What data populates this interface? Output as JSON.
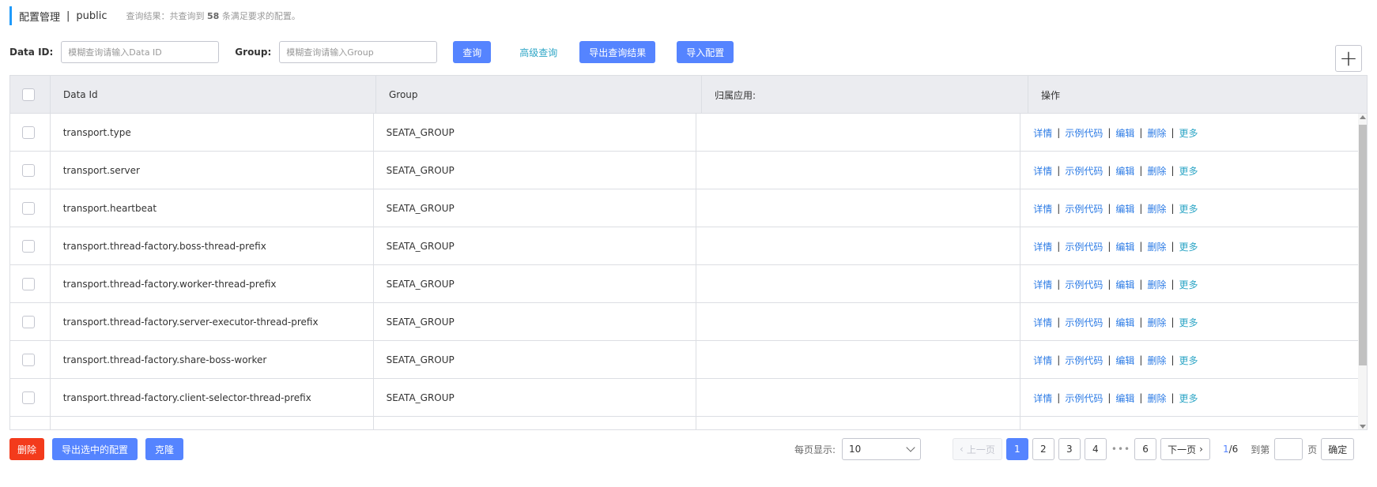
{
  "header": {
    "title": "配置管理",
    "separator": "|",
    "namespace": "public",
    "result_prefix": "查询结果：共查询到",
    "result_count": "58",
    "result_suffix": "条满足要求的配置。"
  },
  "search": {
    "data_id_label": "Data ID:",
    "data_id_placeholder": "模糊查询请输入Data ID",
    "group_label": "Group:",
    "group_placeholder": "模糊查询请输入Group",
    "query_button": "查询",
    "advanced_query": "高级查询",
    "export_results": "导出查询结果",
    "import_config": "导入配置",
    "add_icon": "plus-icon"
  },
  "table": {
    "columns": [
      "Data Id",
      "Group",
      "归属应用:",
      "操作"
    ],
    "rows": [
      {
        "data_id": "transport.type",
        "group": "SEATA_GROUP",
        "app": ""
      },
      {
        "data_id": "transport.server",
        "group": "SEATA_GROUP",
        "app": ""
      },
      {
        "data_id": "transport.heartbeat",
        "group": "SEATA_GROUP",
        "app": ""
      },
      {
        "data_id": "transport.thread-factory.boss-thread-prefix",
        "group": "SEATA_GROUP",
        "app": ""
      },
      {
        "data_id": "transport.thread-factory.worker-thread-prefix",
        "group": "SEATA_GROUP",
        "app": ""
      },
      {
        "data_id": "transport.thread-factory.server-executor-thread-prefix",
        "group": "SEATA_GROUP",
        "app": ""
      },
      {
        "data_id": "transport.thread-factory.share-boss-worker",
        "group": "SEATA_GROUP",
        "app": ""
      },
      {
        "data_id": "transport.thread-factory.client-selector-thread-prefix",
        "group": "SEATA_GROUP",
        "app": ""
      }
    ],
    "ops": {
      "detail": "详情",
      "sample_code": "示例代码",
      "edit": "编辑",
      "delete": "删除",
      "more": "更多",
      "sep": "|"
    }
  },
  "footer": {
    "delete": "删除",
    "export_selected": "导出选中的配置",
    "clone": "克隆"
  },
  "pagination": {
    "page_size_label": "每页显示:",
    "page_size": "10",
    "prev": "上一页",
    "pages": [
      "1",
      "2",
      "3",
      "4"
    ],
    "ellipsis": "•••",
    "last_page": "6",
    "next": "下一页",
    "current": "1",
    "total_sep": "/6",
    "goto_label": "到第",
    "page_unit": "页",
    "confirm": "确定"
  },
  "colors": {
    "primary": "#5584ff",
    "danger": "#f33b1c",
    "link": "#2c7be5",
    "accent": "#209bfa"
  }
}
